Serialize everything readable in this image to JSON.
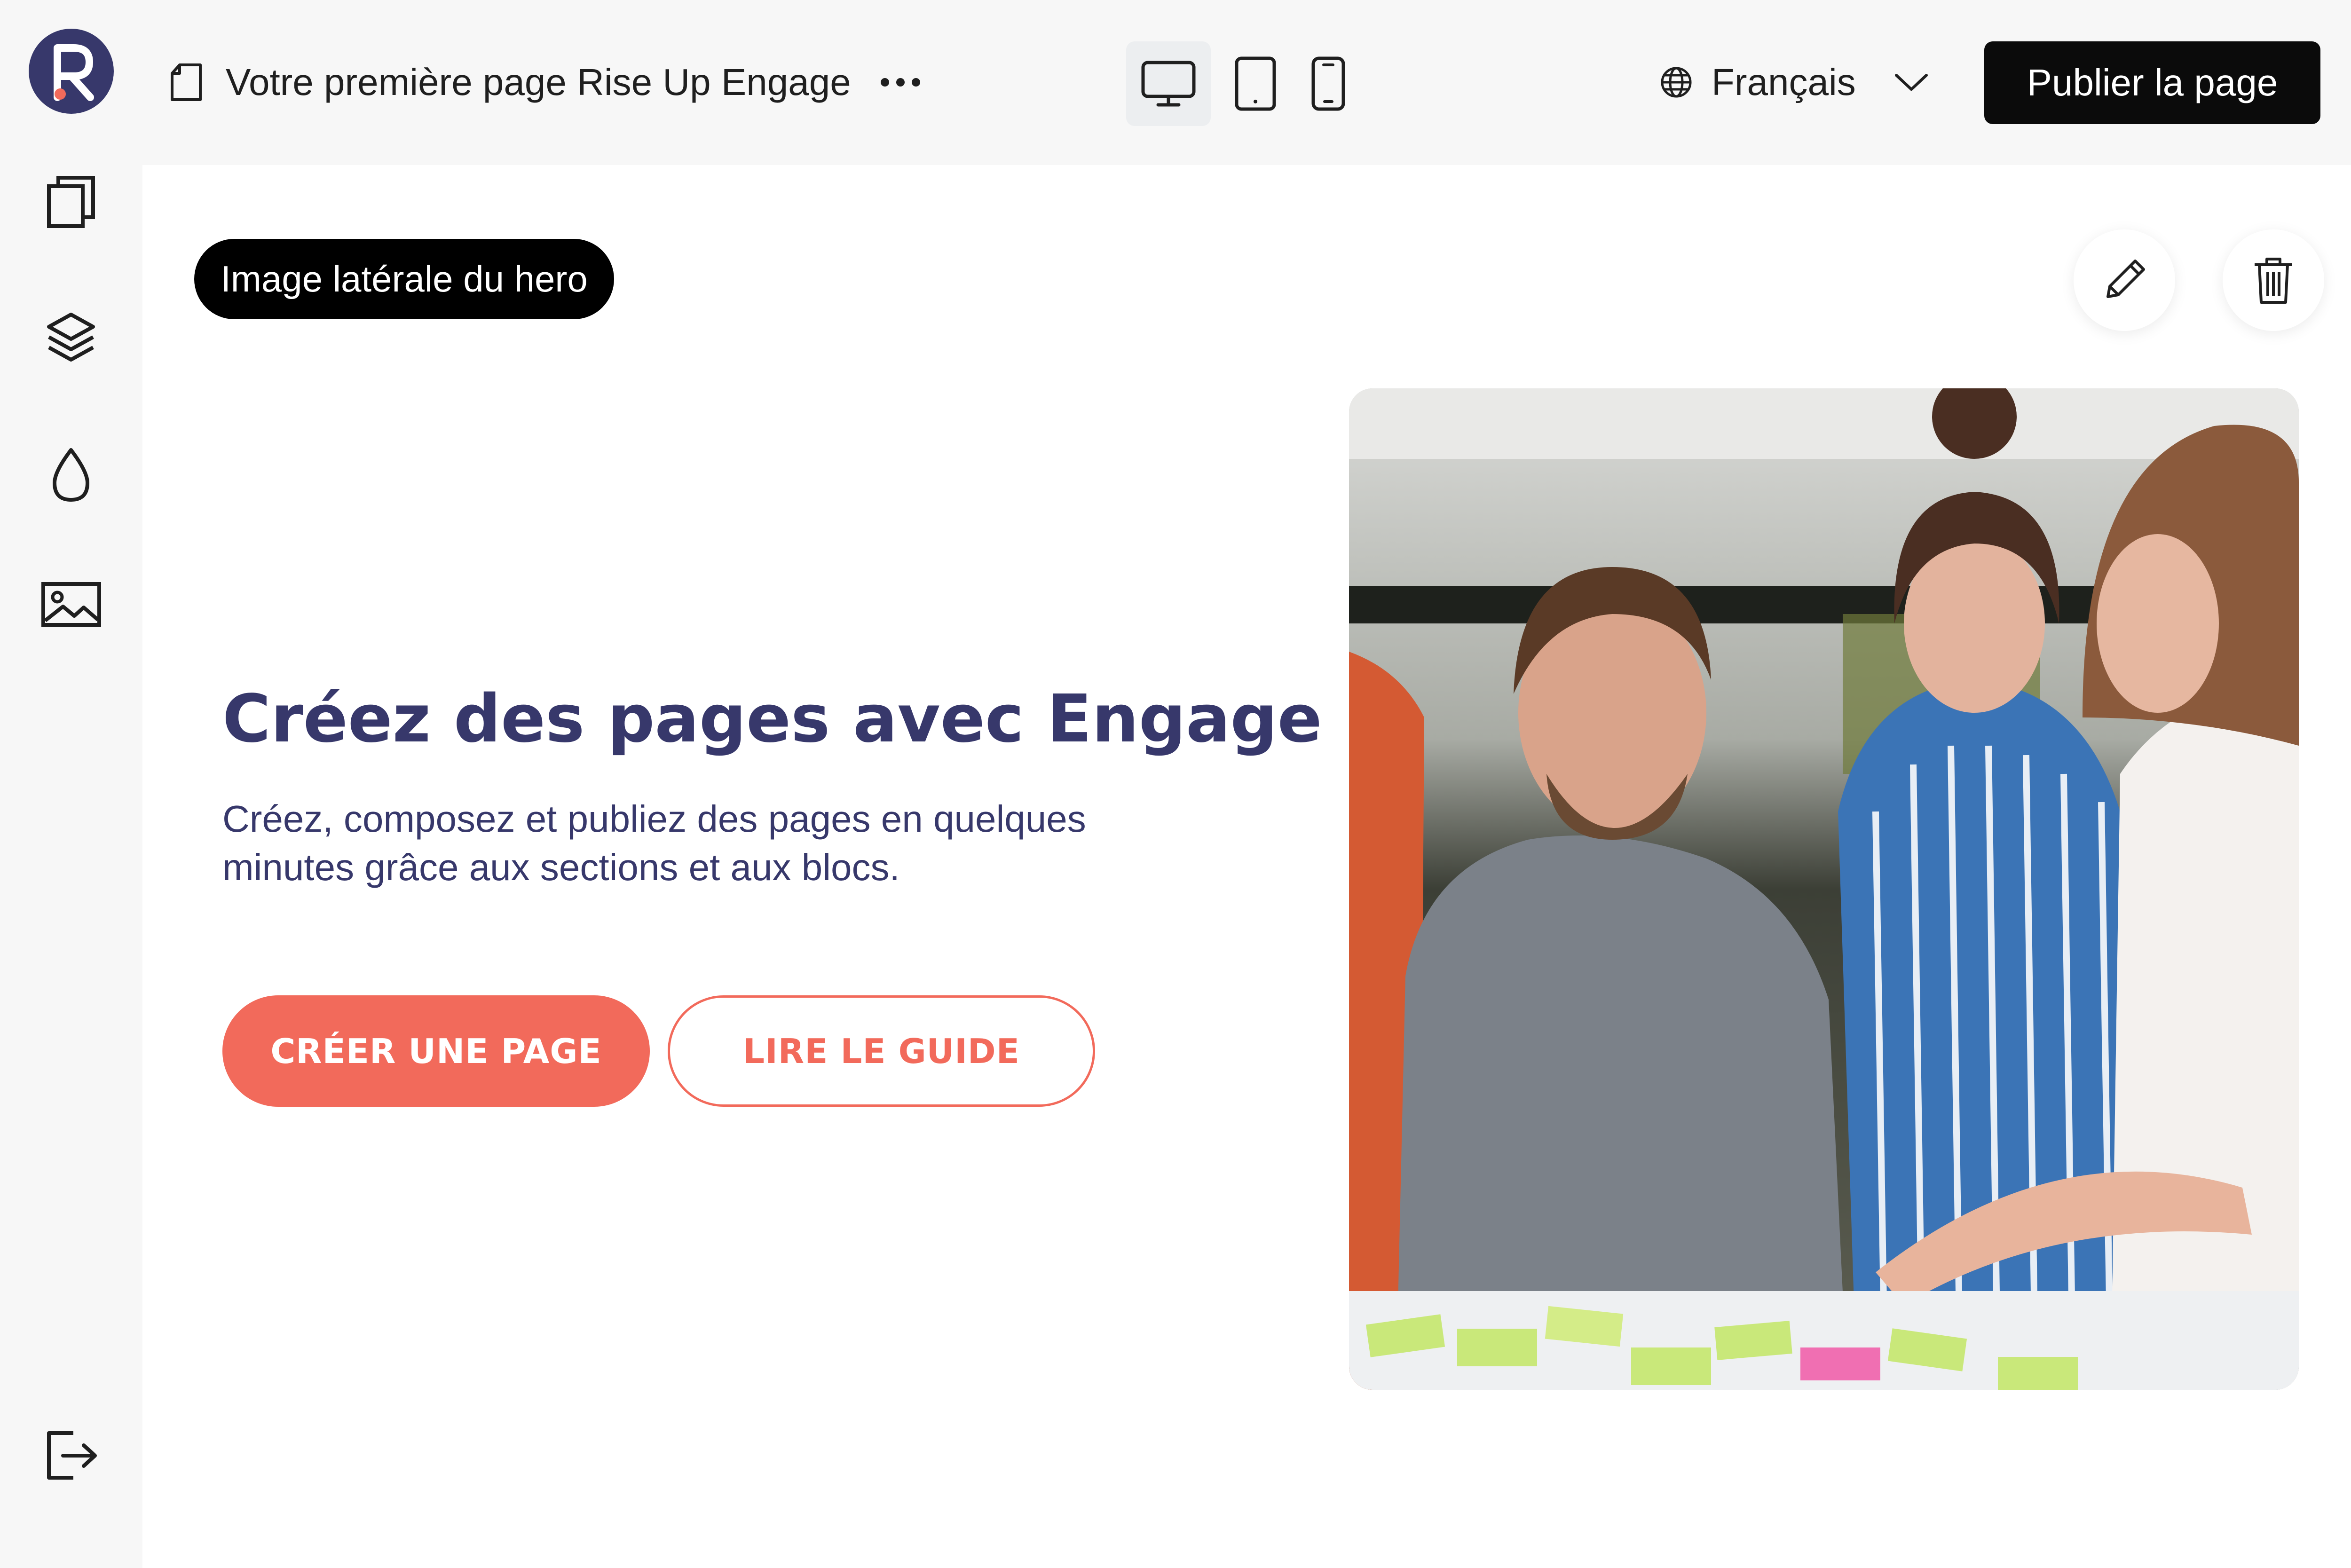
{
  "app": {
    "logo_letter": "R"
  },
  "toolbar": {
    "page_title": "Votre première page Rise Up Engage",
    "more_icon": "ellipsis-horizontal-icon",
    "devices": [
      {
        "name": "desktop",
        "icon": "desktop-icon",
        "active": true
      },
      {
        "name": "tablet",
        "icon": "tablet-icon",
        "active": false
      },
      {
        "name": "mobile",
        "icon": "mobile-icon",
        "active": false
      }
    ],
    "language": "Français",
    "publish_label": "Publier la page"
  },
  "sidebar": {
    "items": [
      {
        "icon": "pages-icon"
      },
      {
        "icon": "layers-icon"
      },
      {
        "icon": "theme-drop-icon"
      },
      {
        "icon": "media-image-icon"
      }
    ],
    "logout_icon": "logout-icon"
  },
  "editor": {
    "section_tag": "Image latérale du hero",
    "edit_icon": "pencil-icon",
    "delete_icon": "trash-icon"
  },
  "hero": {
    "title": "Créez des pages avec Engage",
    "subtitle": "Créez, composez et publiez des pages en quelques minutes grâce aux sections et aux blocs.",
    "primary_cta": "CRÉER UNE PAGE",
    "secondary_cta": "LIRE LE GUIDE"
  },
  "colors": {
    "brand": "#37386b",
    "accent": "#f26a5b",
    "publish_bg": "#0b0b0b"
  }
}
